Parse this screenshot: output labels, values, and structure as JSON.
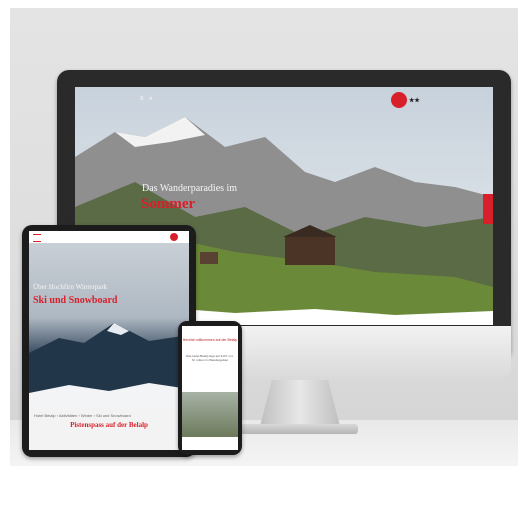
{
  "desktop": {
    "hero_title": "Das Wanderparadies im",
    "hero_subtitle": "Sommer",
    "menu_icons": "≡ ⌕",
    "brand_text": "★★"
  },
  "tablet": {
    "hero_title": "Über Hochfirn Winterpark",
    "hero_subtitle": "Ski und Snowboard",
    "breadcrumb": "Hotel Belalp › Aktivitäten › Winter › Ski und Snowboard",
    "section_title": "Pistenspass auf der Belalp"
  },
  "phone": {
    "head": "Herzlich willkommen auf der Belalp",
    "text": "Das Hotel Belalp liegt auf 2137 m ü. M. mitten im Wandergebiet"
  },
  "colors": {
    "accent": "#d8202a",
    "device": "#1c1c1c",
    "background": "#e4e4e4"
  }
}
